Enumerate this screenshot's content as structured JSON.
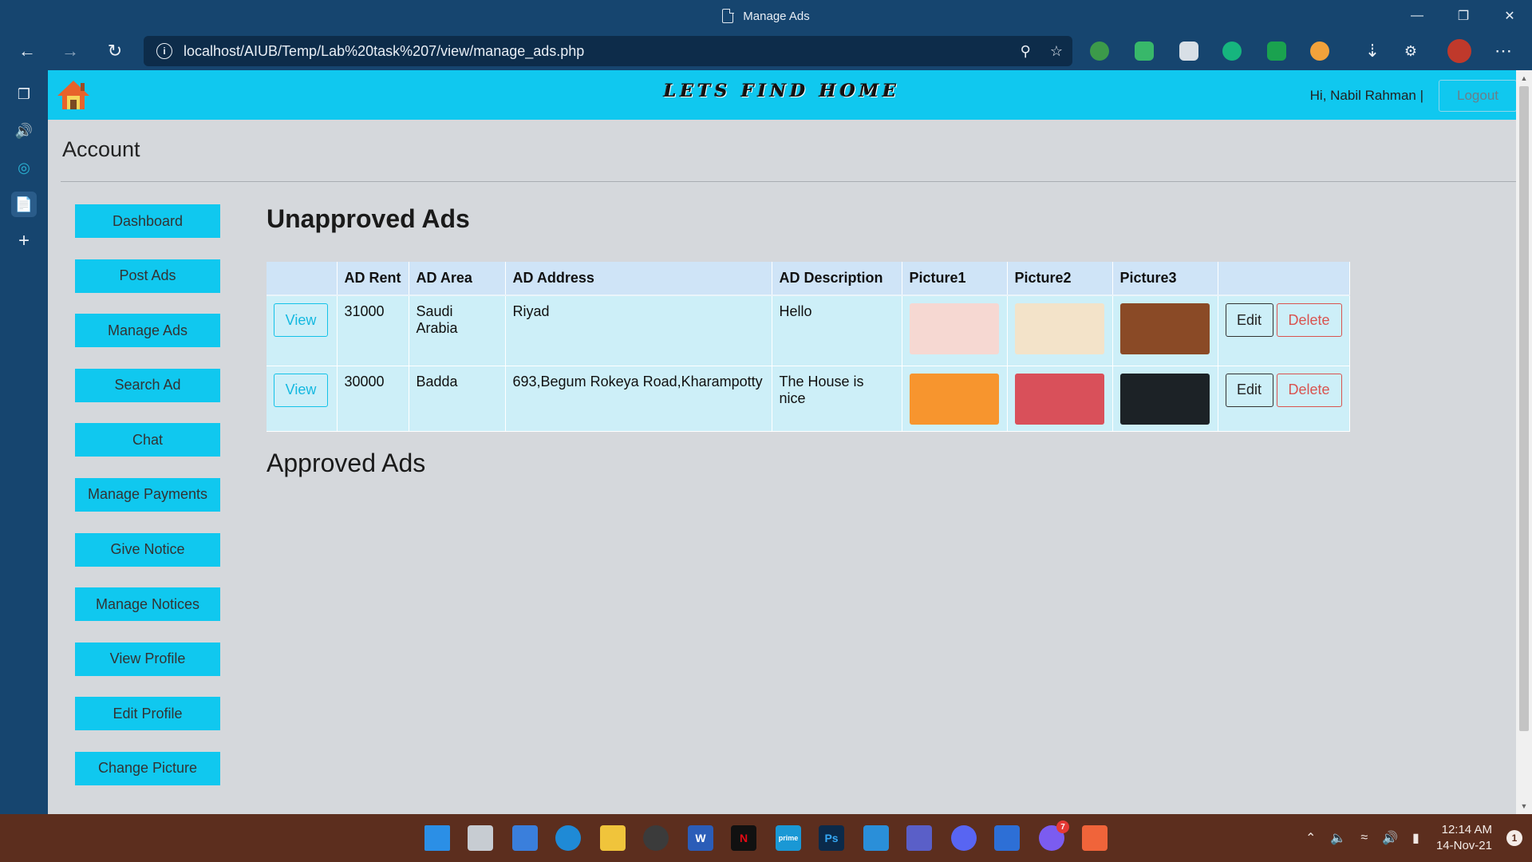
{
  "window": {
    "title": "Manage Ads"
  },
  "browser": {
    "url": "localhost/AIUB/Temp/Lab%20task%207/view/manage_ads.php",
    "icons": [
      "back-icon",
      "forward-icon",
      "refresh-icon",
      "info-icon",
      "zoom-icon",
      "favorite-icon",
      "download-icon",
      "extensions-icon",
      "profile-avatar",
      "more-icon"
    ]
  },
  "site": {
    "brand": "Lets Find Home",
    "greeting": "Hi, Nabil Rahman  |",
    "logout_label": "Logout"
  },
  "page": {
    "account_heading": "Account",
    "unapproved_heading": "Unapproved Ads",
    "approved_heading": "Approved Ads"
  },
  "nav": [
    {
      "label": "Dashboard"
    },
    {
      "label": "Post Ads"
    },
    {
      "label": "Manage Ads"
    },
    {
      "label": "Search Ad"
    },
    {
      "label": "Chat"
    },
    {
      "label": "Manage Payments"
    },
    {
      "label": "Give Notice"
    },
    {
      "label": "Manage Notices"
    },
    {
      "label": "View Profile"
    },
    {
      "label": "Edit Profile"
    },
    {
      "label": "Change Picture"
    }
  ],
  "table": {
    "headers": [
      "",
      "AD Rent",
      "AD Area",
      "AD Address",
      "AD Description",
      "Picture1",
      "Picture2",
      "Picture3",
      ""
    ],
    "view_label": "View",
    "edit_label": "Edit",
    "delete_label": "Delete",
    "rows": [
      {
        "rent": "31000",
        "area": "Saudi Arabia",
        "address": "Riyad",
        "description": "Hello",
        "pics": [
          {
            "color": "#f6d8d2"
          },
          {
            "color": "#f3e3c9"
          },
          {
            "color": "#8a4a26"
          }
        ]
      },
      {
        "rent": "30000",
        "area": "Badda",
        "address": "693,Begum Rokeya Road,Kharampotty",
        "description": "The House is nice",
        "pics": [
          {
            "color": "#f7952e"
          },
          {
            "color": "#d9505a"
          },
          {
            "color": "#1c2226"
          }
        ]
      }
    ]
  },
  "taskbar": {
    "clock_time": "12:14 AM",
    "clock_date": "14-Nov-21",
    "notification_count": "1",
    "messenger_badge": "7"
  },
  "colors": {
    "header_cyan": "#10c8ef",
    "page_bg": "#d5d8dc",
    "browser_chrome": "#16456f",
    "taskbar": "#5c2e1e"
  }
}
